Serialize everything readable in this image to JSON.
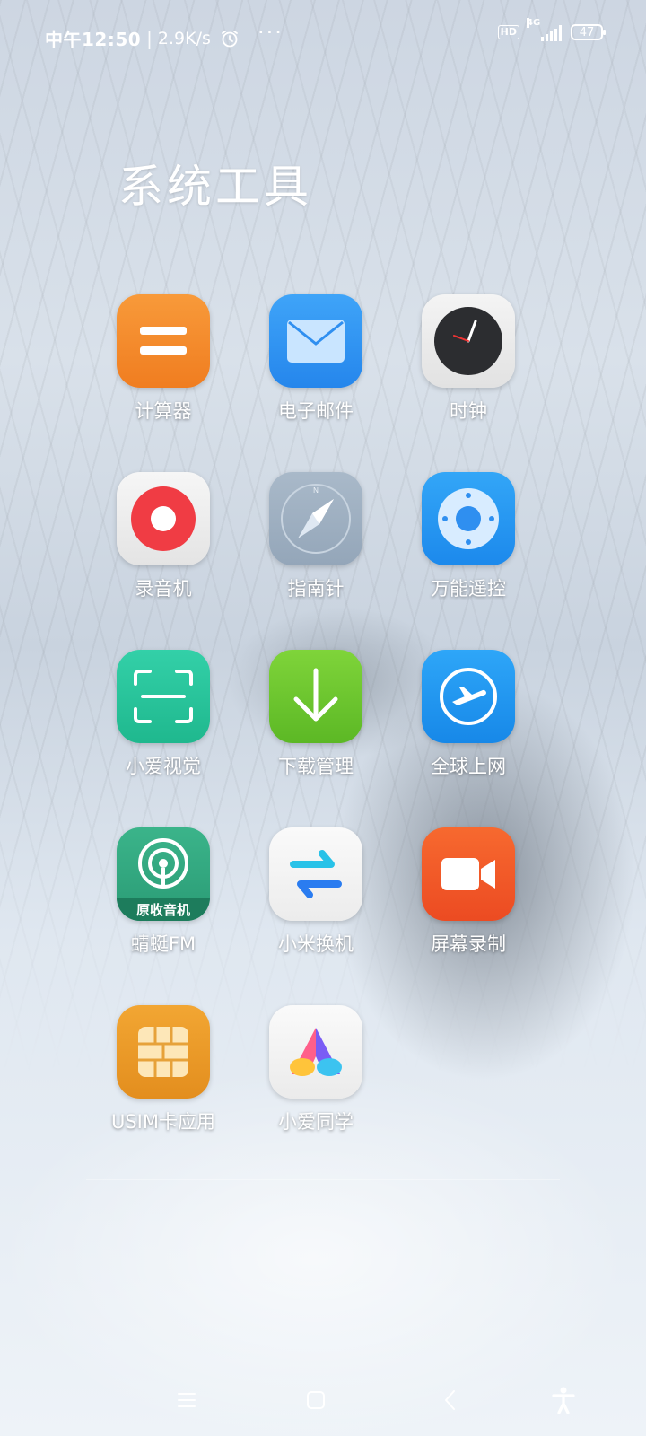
{
  "status_bar": {
    "time": "中午12:50",
    "separator": "|",
    "network_speed": "2.9K/s",
    "more_indicator": "···",
    "hd_label": "HD",
    "network_type": "4G",
    "battery_level": "47"
  },
  "folder": {
    "title": "系统工具",
    "apps": [
      {
        "label": "计算器",
        "icon": "calculator-icon"
      },
      {
        "label": "电子邮件",
        "icon": "email-icon"
      },
      {
        "label": "时钟",
        "icon": "clock-icon"
      },
      {
        "label": "录音机",
        "icon": "recorder-icon"
      },
      {
        "label": "指南针",
        "icon": "compass-icon"
      },
      {
        "label": "万能遥控",
        "icon": "remote-control-icon"
      },
      {
        "label": "小爱视觉",
        "icon": "scan-icon"
      },
      {
        "label": "下载管理",
        "icon": "download-icon"
      },
      {
        "label": "全球上网",
        "icon": "global-network-icon"
      },
      {
        "label": "蜻蜓FM",
        "icon": "radio-icon",
        "badge": "原收音机"
      },
      {
        "label": "小米换机",
        "icon": "transfer-icon"
      },
      {
        "label": "屏幕录制",
        "icon": "screen-record-icon"
      },
      {
        "label": "USIM卡应用",
        "icon": "sim-card-icon"
      },
      {
        "label": "小爱同学",
        "icon": "xiaoai-icon"
      }
    ]
  },
  "nav_bar": {
    "items": [
      "menu-icon",
      "home-icon",
      "back-icon",
      "accessibility-icon"
    ]
  },
  "colors": {
    "calculator": "#f5862a",
    "email": "#2f8ff0",
    "remote": "#2196f3",
    "scan": "#24c39a",
    "download": "#6cc62c",
    "radio": "#2fa07a",
    "screen_record": "#f0582a",
    "sim": "#e89a28"
  }
}
